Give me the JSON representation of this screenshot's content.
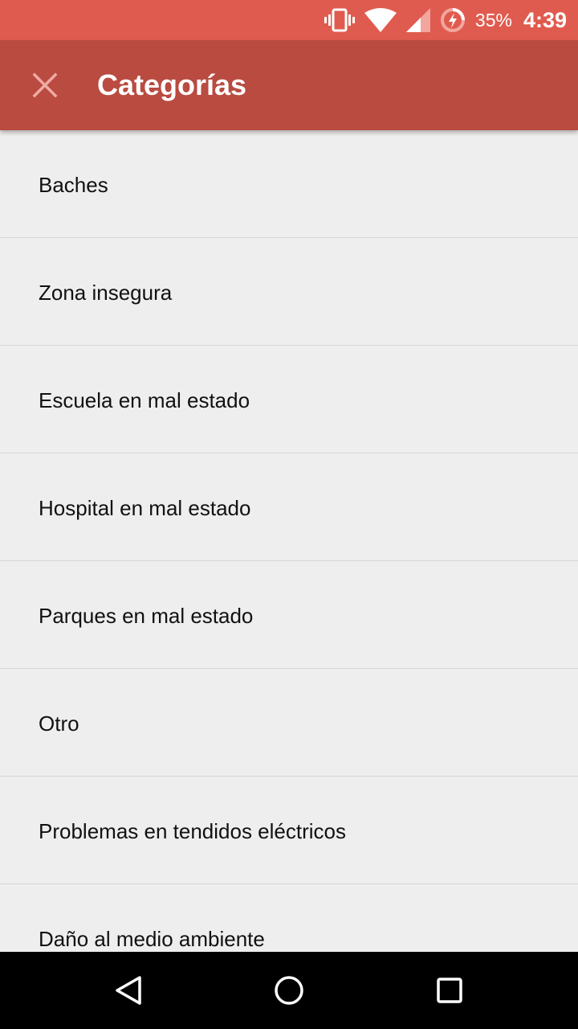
{
  "colors": {
    "status_bar": "#e05b4f",
    "app_bar": "#b94b40",
    "list_background": "#eeeeee",
    "divider": "#d6d6d6",
    "nav_bar": "#000000"
  },
  "status_bar": {
    "icons": [
      "vibrate-icon",
      "wifi-icon",
      "cell-signal-icon",
      "battery-charging-icon"
    ],
    "battery_percent": "35%",
    "time": "4:39"
  },
  "app_bar": {
    "close_icon": "close-icon",
    "title": "Categorías"
  },
  "categories": [
    {
      "label": "Baches"
    },
    {
      "label": "Zona insegura"
    },
    {
      "label": "Escuela en mal estado"
    },
    {
      "label": "Hospital en mal estado"
    },
    {
      "label": "Parques en mal estado"
    },
    {
      "label": "Otro"
    },
    {
      "label": "Problemas en tendidos eléctricos"
    },
    {
      "label": "Daño al medio ambiente"
    }
  ],
  "nav_bar": {
    "icons": [
      "back-icon",
      "home-icon",
      "recents-icon"
    ]
  }
}
